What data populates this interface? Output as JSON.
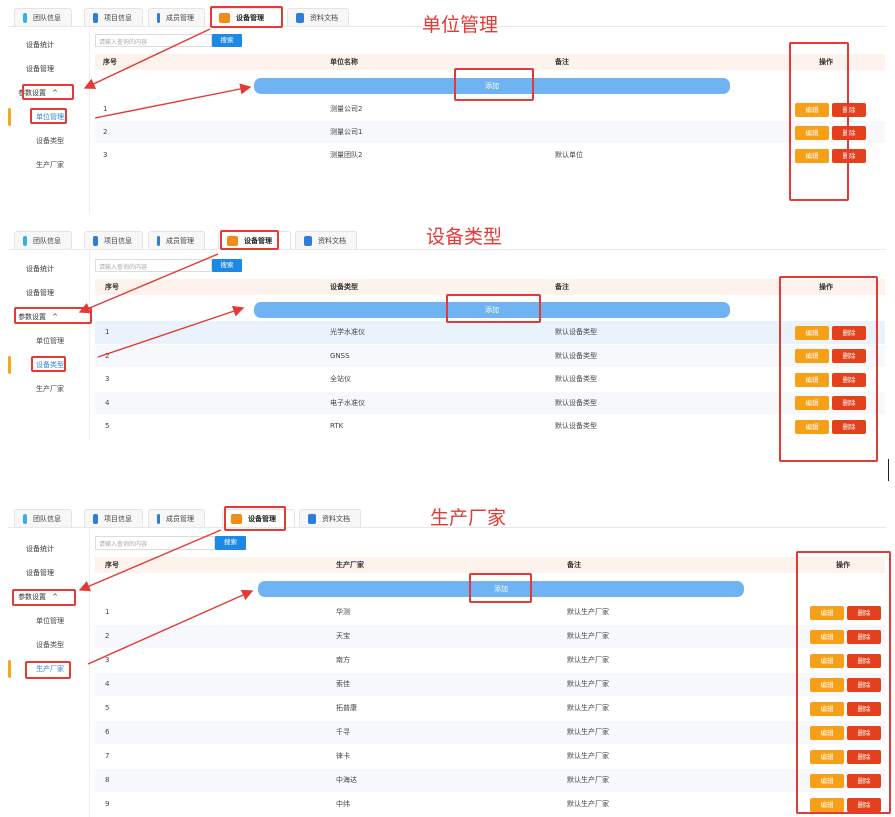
{
  "tabs": [
    {
      "label": "团队信息",
      "icon": "team-icon",
      "color": "#35b0e6"
    },
    {
      "label": "项目信息",
      "icon": "folder-icon",
      "color": "#2e7dd8"
    },
    {
      "label": "成员管理",
      "icon": "members-icon",
      "color": "#2e7dd8"
    },
    {
      "label": "设备管理",
      "icon": "tripod-icon",
      "color": "#f08c1a"
    },
    {
      "label": "资料文档",
      "icon": "document-icon",
      "color": "#2e7dd8"
    }
  ],
  "sidebar": {
    "stats": "设备统计",
    "manage": "设备管理",
    "params": "参数设置",
    "caret": "^",
    "units": "单位管理",
    "types": "设备类型",
    "makers": "生产厂家"
  },
  "search": {
    "placeholder": "请输入查询的内容",
    "button": "搜索"
  },
  "add_label": "添加",
  "edit_label": "编辑",
  "delete_label": "删除",
  "ops_header": "操作",
  "col_index": "序号",
  "col_remark": "备注",
  "sections": {
    "units": {
      "title": "单位管理",
      "col_name": "单位名称",
      "rows": [
        {
          "no": "1",
          "name": "测量公司2",
          "remark": ""
        },
        {
          "no": "2",
          "name": "测量公司1",
          "remark": ""
        },
        {
          "no": "3",
          "name": "测量团队2",
          "remark": "默认单位"
        }
      ]
    },
    "types": {
      "title": "设备类型",
      "col_name": "设备类型",
      "rows": [
        {
          "no": "1",
          "name": "光学水准仪",
          "remark": "默认设备类型"
        },
        {
          "no": "2",
          "name": "GNSS",
          "remark": "默认设备类型"
        },
        {
          "no": "3",
          "name": "全站仪",
          "remark": "默认设备类型"
        },
        {
          "no": "4",
          "name": "电子水准仪",
          "remark": "默认设备类型"
        },
        {
          "no": "5",
          "name": "RTK",
          "remark": "默认设备类型"
        }
      ]
    },
    "makers": {
      "title": "生产厂家",
      "col_name": "生产厂家",
      "rows": [
        {
          "no": "1",
          "name": "华测",
          "remark": "默认生产厂家"
        },
        {
          "no": "2",
          "name": "天宝",
          "remark": "默认生产厂家"
        },
        {
          "no": "3",
          "name": "南方",
          "remark": "默认生产厂家"
        },
        {
          "no": "4",
          "name": "索佳",
          "remark": "默认生产厂家"
        },
        {
          "no": "5",
          "name": "拓普康",
          "remark": "默认生产厂家"
        },
        {
          "no": "6",
          "name": "千寻",
          "remark": "默认生产厂家"
        },
        {
          "no": "7",
          "name": "徕卡",
          "remark": "默认生产厂家"
        },
        {
          "no": "8",
          "name": "中海达",
          "remark": "默认生产厂家"
        },
        {
          "no": "9",
          "name": "中纬",
          "remark": "默认生产厂家"
        }
      ]
    }
  },
  "colors": {
    "annotation": "#e53935",
    "add_bar": "#6fb3f2",
    "search_btn": "#1e88e5",
    "edit": "#f5a016",
    "delete": "#e2411b",
    "active_marker": "#f5a623"
  }
}
